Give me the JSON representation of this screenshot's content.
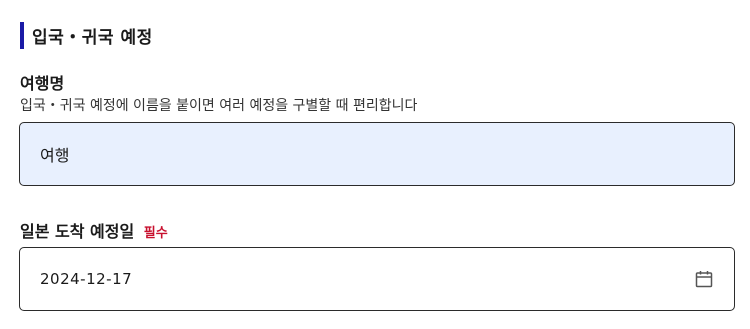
{
  "section": {
    "title": "입국・귀국 예정"
  },
  "trip_name": {
    "label": "여행명",
    "hint": "입국・귀국 예정에 이름을 붙이면 여러 예정을 구별할 때 편리합니다",
    "value": "여행"
  },
  "arrival_date": {
    "label": "일본 도착 예정일",
    "required_tag": "필수",
    "value": "2024-12-17",
    "icon": "calendar-icon"
  },
  "colors": {
    "accent_bar": "#1a1aa6",
    "required": "#c8102e",
    "autofill_bg": "#e8f0fe"
  }
}
